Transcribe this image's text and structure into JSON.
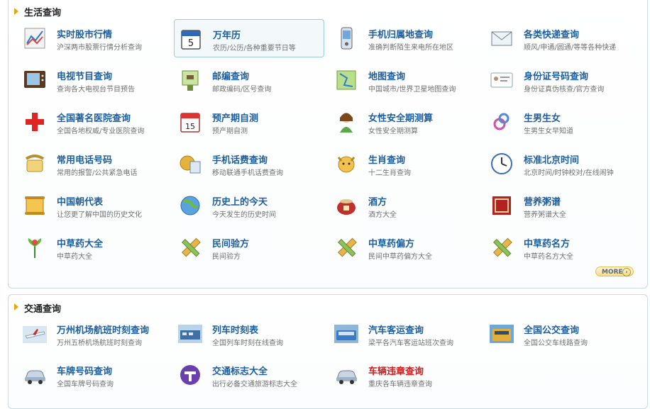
{
  "life": {
    "title": "生活查询",
    "more_label": "MORE",
    "items": [
      {
        "title": "实时股市行情",
        "desc": "沪深两市股票行情分析查询",
        "icon": "stock-chart-icon"
      },
      {
        "title": "万年历",
        "desc": "农历/公历/各种重要节日等",
        "icon": "calendar-icon"
      },
      {
        "title": "手机归属地查询",
        "desc": "准确判断陌生来电所在地区",
        "icon": "mobile-phone-icon"
      },
      {
        "title": "各类快递查询",
        "desc": "顺风/申通/圆通/等等各种快递",
        "icon": "envelope-icon"
      },
      {
        "title": "电视节目查询",
        "desc": "查询各大电视台节目预告",
        "icon": "tv-icon"
      },
      {
        "title": "邮编查询",
        "desc": "邮政编码/区号查询",
        "icon": "postbox-icon"
      },
      {
        "title": "地图查询",
        "desc": "中国城市/世界卫星地图查询",
        "icon": "map-icon"
      },
      {
        "title": "身份证号码查询",
        "desc": "身份证真伪核查/官方查询",
        "icon": "id-card-icon"
      },
      {
        "title": "全国著名医院查询",
        "desc": "全国各地权威/专业医院查询",
        "icon": "hospital-cross-icon"
      },
      {
        "title": "预产期自测",
        "desc": "预产期自测",
        "icon": "date-calendar-icon"
      },
      {
        "title": "女性安全期测算",
        "desc": "女性安全期测算",
        "icon": "woman-icon"
      },
      {
        "title": "生男生女",
        "desc": "生男生女早知道",
        "icon": "gender-icon"
      },
      {
        "title": "常用电话号码",
        "desc": "常用的报警/公共紧急电话",
        "icon": "telephone-icon"
      },
      {
        "title": "手机话费查询",
        "desc": "移动联通手机话费查询",
        "icon": "coin-bill-icon"
      },
      {
        "title": "生肖查询",
        "desc": "十二生肖查询",
        "icon": "zodiac-ox-icon"
      },
      {
        "title": "标准北京时间",
        "desc": "北京时间/时钟校对/在线闹钟",
        "icon": "clock-icon"
      },
      {
        "title": "中国朝代表",
        "desc": "让您更了解中国的历史文化",
        "icon": "scroll-icon"
      },
      {
        "title": "历史上的今天",
        "desc": "今天发生的历史时间",
        "icon": "globe-icon"
      },
      {
        "title": "酒方",
        "desc": "酒方大全",
        "icon": "wine-jar-icon"
      },
      {
        "title": "营养粥谱",
        "desc": "营养粥谱大全",
        "icon": "porridge-seal-icon"
      },
      {
        "title": "中草药大全",
        "desc": "中草药大全",
        "icon": "herb-plant-icon"
      },
      {
        "title": "民间验方",
        "desc": "民间验方",
        "icon": "pencil-ruler-icon"
      },
      {
        "title": "中草药偏方",
        "desc": "民间中草药偏方大全",
        "icon": "pencil-ruler-icon"
      },
      {
        "title": "中草药名方",
        "desc": "中草药名方大全",
        "icon": "pencil-ruler-icon"
      }
    ]
  },
  "traffic": {
    "title": "交通查询",
    "items": [
      {
        "title": "万州机场航班时刻查询",
        "desc": "万州五桥机场航班时刻查询",
        "icon": "airplane-icon"
      },
      {
        "title": "列车时刻表",
        "desc": "全国列车时刻在线查询",
        "icon": "train-icon"
      },
      {
        "title": "汽车客运查询",
        "desc": "梁平各汽车客运站班次查询",
        "icon": "coach-bus-icon"
      },
      {
        "title": "全国公交查询",
        "desc": "全国公交车线路查询",
        "icon": "city-bus-icon"
      },
      {
        "title": "车牌号码查询",
        "desc": "全国车牌号码查询",
        "icon": "car-icon"
      },
      {
        "title": "交通标志大全",
        "desc": "出行必备交通旅游标志大全",
        "icon": "traffic-sign-icon"
      },
      {
        "title": "车辆违章查询",
        "desc": "重庆各车辆违章查询",
        "icon": "car-icon"
      }
    ]
  }
}
